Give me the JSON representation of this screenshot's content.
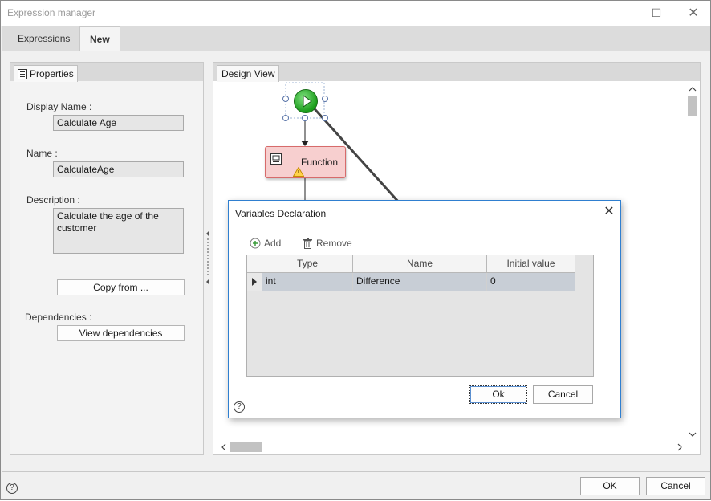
{
  "window": {
    "title": "Expression manager",
    "minimize": "—",
    "maximize": "☐",
    "close": "✕"
  },
  "tabs": [
    {
      "label": "Expressions",
      "active": false
    },
    {
      "label": "New",
      "active": true
    }
  ],
  "properties": {
    "tab_label": "Properties",
    "display_name_label": "Display Name :",
    "display_name_value": "Calculate Age",
    "name_label": "Name :",
    "name_value": "CalculateAge",
    "description_label": "Description :",
    "description_value": "Calculate the age of the customer",
    "copy_from_label": "Copy from ...",
    "dependencies_label": "Dependencies :",
    "view_dependencies_label": "View dependencies"
  },
  "design_view": {
    "tab_label": "Design View",
    "function_node_label": "Function"
  },
  "variables_dialog": {
    "title": "Variables Declaration",
    "add_label": "Add",
    "remove_label": "Remove",
    "columns": [
      "Type",
      "Name",
      "Initial value"
    ],
    "rows": [
      {
        "type": "int",
        "name": "Difference",
        "initial_value": "0"
      }
    ],
    "ok_label": "Ok",
    "cancel_label": "Cancel",
    "help_glyph": "?"
  },
  "footer": {
    "ok_label": "OK",
    "cancel_label": "Cancel",
    "help_glyph": "?"
  },
  "colors": {
    "accent": "#2f7fd0",
    "start_node": "#1a9c1a",
    "function_node": "#f7cfcf",
    "selected_row": "#c8ced6"
  }
}
